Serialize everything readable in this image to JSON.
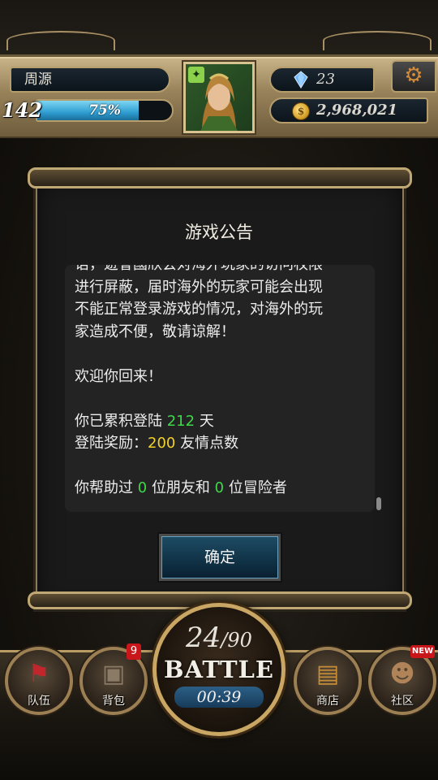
{
  "player": {
    "name": "周源",
    "level": "142",
    "xp_percent_label": "75%",
    "xp_fraction": 0.75
  },
  "currency": {
    "gems": "23",
    "gold": "2,968,021"
  },
  "icons": {
    "gem": "gem-icon",
    "coin": "coin-icon",
    "settings": "gear-icon",
    "portrait_element": "leaf-icon"
  },
  "dialog": {
    "title": "游戏公告",
    "notice_lines": [
      "语，遊會國欣会对海外玩家的访问权限",
      "进行屏蔽，届时海外的玩家可能会出现",
      "不能正常登录游戏的情况，对海外的玩",
      "家造成不便，敬请谅解！"
    ],
    "welcome": "欢迎你回来！",
    "login_days": {
      "prefix": "你已累积登陆 ",
      "value": "212",
      "suffix": " 天"
    },
    "login_reward": {
      "prefix": "登陆奖励：",
      "value": "200",
      "suffix": " 友情点数"
    },
    "helped": {
      "prefix": "你帮助过 ",
      "friends": "0",
      "middle": " 位朋友和 ",
      "adventurers": "0",
      "suffix": " 位冒险者"
    },
    "confirm_label": "确定"
  },
  "nav": {
    "team_label": "队伍",
    "bag_label": "背包",
    "bag_badge": "9",
    "shop_label": "商店",
    "community_label": "社区",
    "community_badge": "NEW"
  },
  "battle": {
    "stamina_current": "24",
    "stamina_max": "/90",
    "label": "BATTLE",
    "timer": "00:39"
  }
}
